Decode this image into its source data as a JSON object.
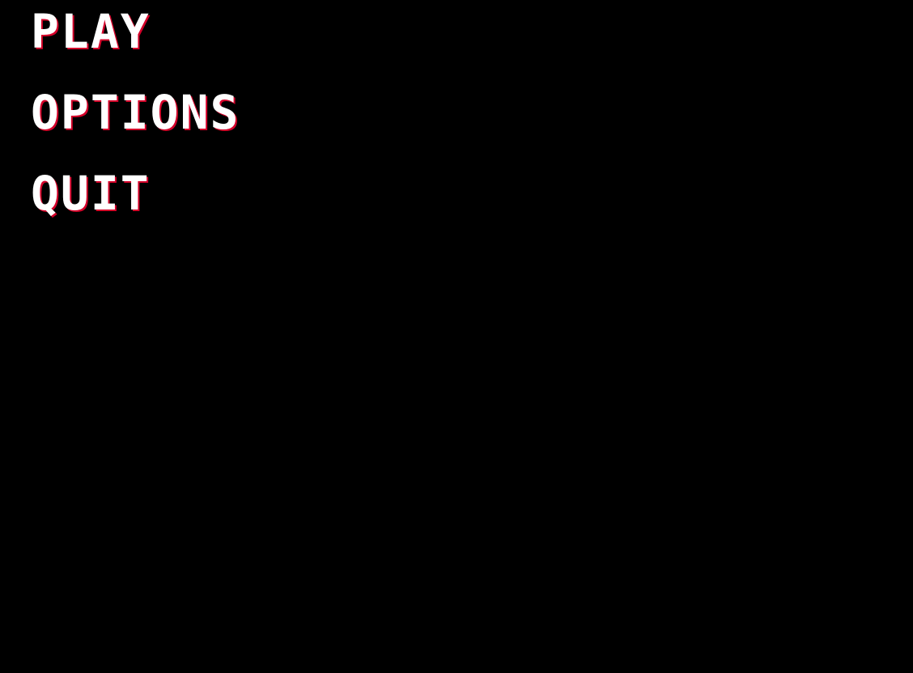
{
  "menu": {
    "items": [
      {
        "label": "PLAY"
      },
      {
        "label": "OPTIONS"
      },
      {
        "label": "QUIT"
      }
    ]
  },
  "colors": {
    "background": "#000000",
    "text": "#ffffff",
    "shadow": "#d4002a"
  }
}
